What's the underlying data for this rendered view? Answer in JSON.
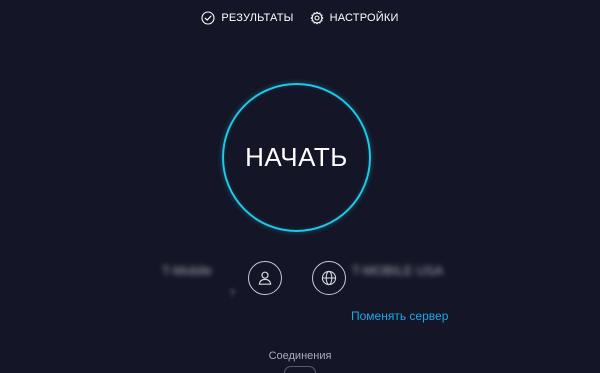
{
  "nav": {
    "results_label": "РЕЗУЛЬТАТЫ",
    "results_icon": "check-circle-icon",
    "settings_label": "НАСТРОЙКИ",
    "settings_icon": "gear-icon"
  },
  "start": {
    "label": "НАЧАТЬ",
    "ring_color": "#1fc8e6"
  },
  "provider": {
    "name": "T-Mobile",
    "sub": "?",
    "icon": "user-icon"
  },
  "server": {
    "name": "T-MOBILE USA",
    "icon": "globe-icon",
    "change_label": "Поменять сервер",
    "link_color": "#1fa6e8"
  },
  "connections": {
    "label": "Соединения"
  },
  "colors": {
    "background": "#141526",
    "accent": "#1fc8e6"
  }
}
